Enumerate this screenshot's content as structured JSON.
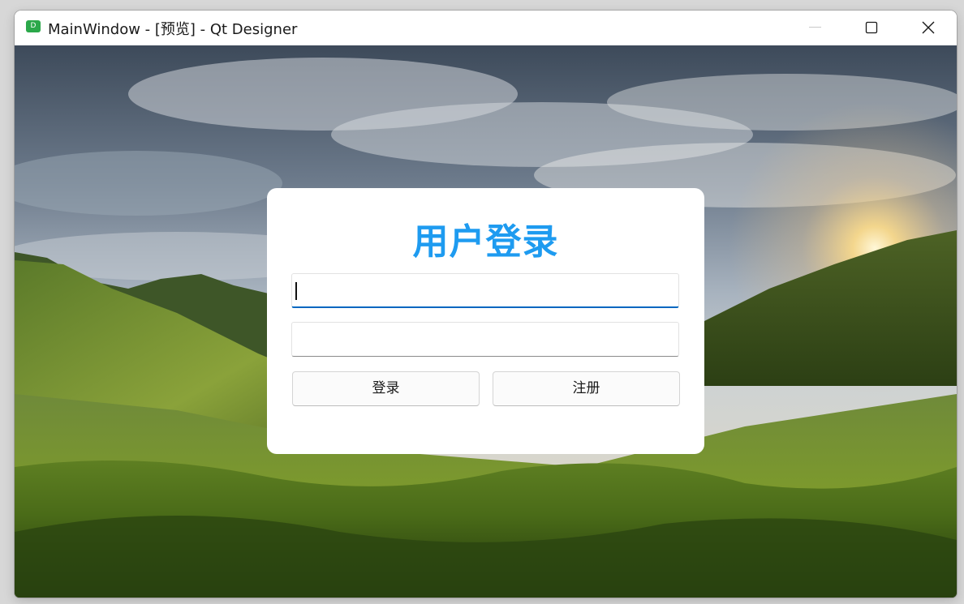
{
  "window": {
    "title": "MainWindow - [预览] - Qt Designer",
    "app_icon": "qt-designer-icon",
    "app_icon_letter": "D",
    "controls": [
      "minimize-icon",
      "maximize-icon",
      "close-icon"
    ]
  },
  "background": {
    "description_icon": "mountain-landscape-image"
  },
  "login": {
    "title": "用户登录",
    "title_color": "#1e9bf0",
    "username_value": "",
    "password_value": "",
    "login_label": "登录",
    "register_label": "注册",
    "focus_color": "#0067c0"
  }
}
